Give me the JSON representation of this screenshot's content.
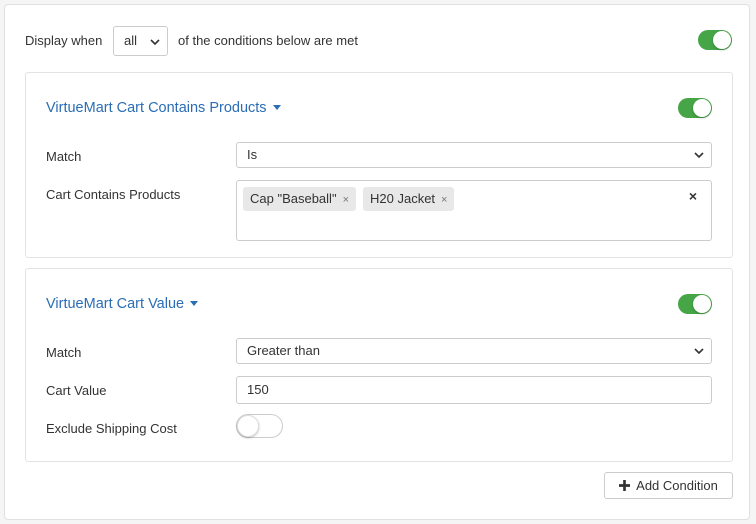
{
  "header": {
    "display_when_label": "Display when",
    "match_all_select": "all",
    "conditions_suffix": "of the conditions below are met",
    "enabled": true
  },
  "conditions": [
    {
      "title": "VirtueMart Cart Contains Products",
      "enabled": true,
      "match_label": "Match",
      "match_value": "Is",
      "field_label": "Cart Contains Products",
      "chips": [
        "Cap \"Baseball\"",
        "H20 Jacket"
      ],
      "chip_remove_glyph": "×",
      "clear_glyph": "×"
    },
    {
      "title": "VirtueMart Cart Value",
      "enabled": true,
      "match_label": "Match",
      "match_value": "Greater than",
      "field_label": "Cart Value",
      "field_value": "150",
      "exclude_label": "Exclude Shipping Cost",
      "exclude_enabled": false
    }
  ],
  "footer": {
    "add_condition_label": "Add Condition"
  },
  "colors": {
    "accent": "#2a6db5",
    "toggle_on": "#46a546"
  }
}
